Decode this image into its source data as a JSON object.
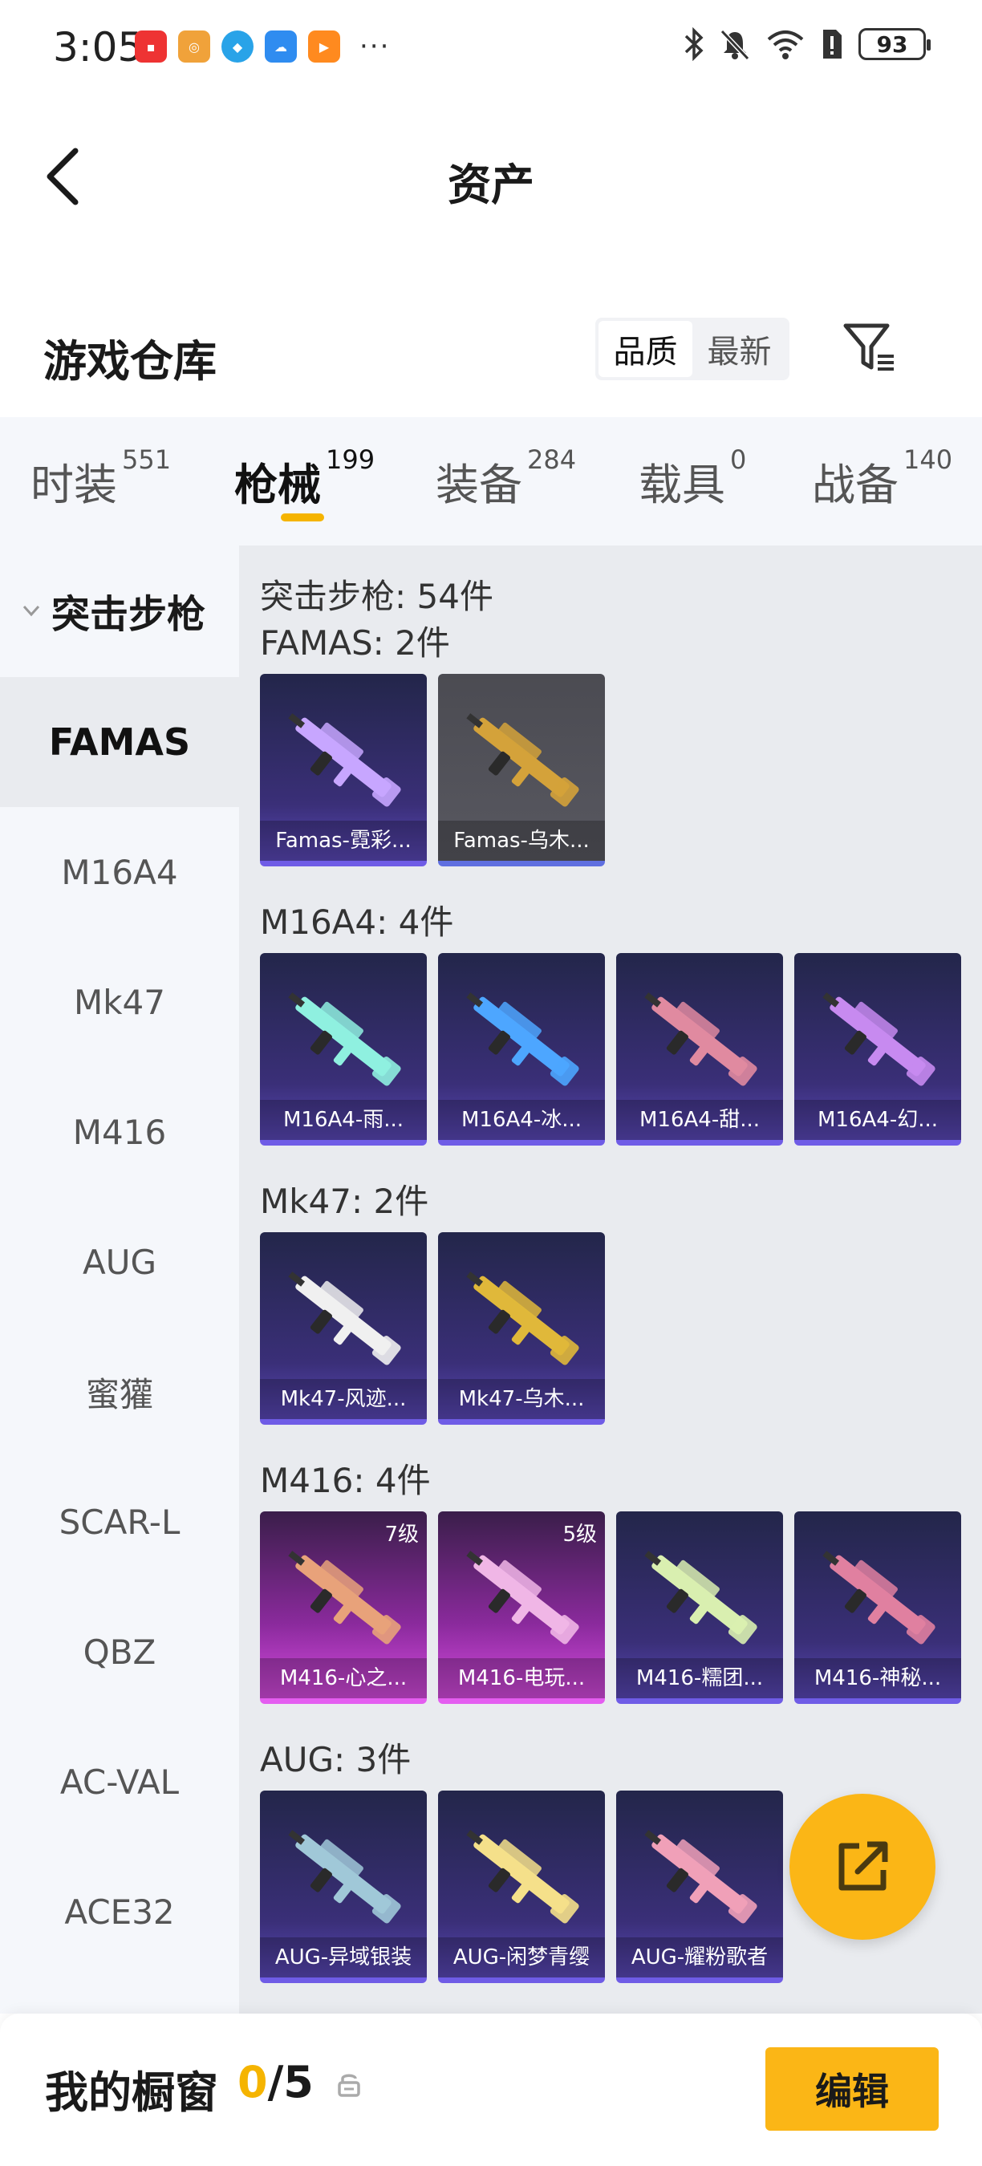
{
  "status_bar": {
    "time": "3:05",
    "battery": "93",
    "app_icons": [
      "huawei-app-icon",
      "music-app-icon",
      "browser-app-icon",
      "weather-app-icon",
      "video-app-icon"
    ],
    "more": "···"
  },
  "header": {
    "title": "资产"
  },
  "section": {
    "title": "游戏仓库",
    "sort_options": [
      "品质",
      "最新"
    ],
    "active_sort": "品质"
  },
  "tabs": [
    {
      "label": "时装",
      "count": "551"
    },
    {
      "label": "枪械",
      "count": "199",
      "active": true
    },
    {
      "label": "装备",
      "count": "284"
    },
    {
      "label": "载具",
      "count": "0"
    },
    {
      "label": "战备",
      "count": "140"
    }
  ],
  "sidebar": {
    "group": "突击步枪",
    "items": [
      "FAMAS",
      "M16A4",
      "Mk47",
      "M416",
      "AUG",
      "蜜獾",
      "SCAR-L",
      "QBZ",
      "AC-VAL",
      "ACE32"
    ],
    "active": "FAMAS"
  },
  "content": {
    "total": "突击步枪: 54件",
    "groups": [
      {
        "title": "FAMAS: 2件",
        "items": [
          {
            "name": "Famas-霓彩...",
            "style": "purple"
          },
          {
            "name": "Famas-乌木...",
            "style": "grey"
          }
        ]
      },
      {
        "title": "M16A4: 4件",
        "items": [
          {
            "name": "M16A4-雨...",
            "style": "purple"
          },
          {
            "name": "M16A4-冰...",
            "style": "purple"
          },
          {
            "name": "M16A4-甜...",
            "style": "purple"
          },
          {
            "name": "M16A4-幻...",
            "style": "purple"
          }
        ]
      },
      {
        "title": "Mk47: 2件",
        "items": [
          {
            "name": "Mk47-风迹...",
            "style": "purple"
          },
          {
            "name": "Mk47-乌木...",
            "style": "purple"
          }
        ]
      },
      {
        "title": "M416: 4件",
        "items": [
          {
            "name": "M416-心之...",
            "style": "pink",
            "level": "7级"
          },
          {
            "name": "M416-电玩...",
            "style": "pink",
            "level": "5级"
          },
          {
            "name": "M416-糯团...",
            "style": "purple"
          },
          {
            "name": "M416-神秘...",
            "style": "purple"
          }
        ]
      },
      {
        "title": "AUG: 3件",
        "items": [
          {
            "name": "AUG-异域银装",
            "style": "purple"
          },
          {
            "name": "AUG-闲梦青缨",
            "style": "purple"
          },
          {
            "name": "AUG-耀粉歌者",
            "style": "purple"
          }
        ]
      }
    ]
  },
  "bottom_bar": {
    "label": "我的橱窗",
    "current": "0",
    "sep_total": "/5",
    "edit": "编辑"
  },
  "colors": {
    "accent": "#fbb616",
    "indicator": "#f5b400",
    "card_purple": "#3a2f78",
    "card_pink": "#d64be0"
  }
}
